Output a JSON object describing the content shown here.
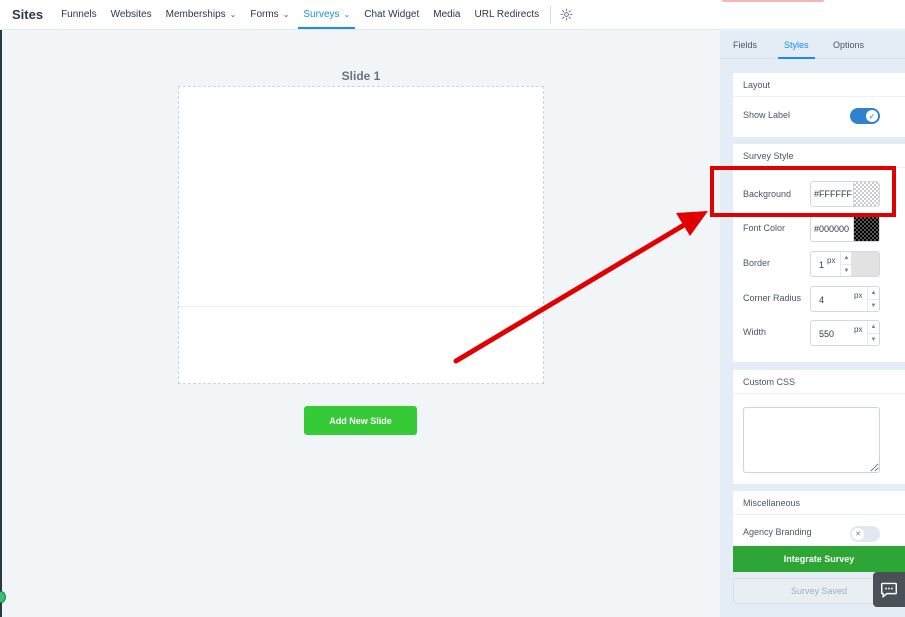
{
  "nav": {
    "brand": "Sites",
    "items": [
      {
        "label": "Funnels"
      },
      {
        "label": "Websites"
      },
      {
        "label": "Memberships"
      },
      {
        "label": "Forms"
      },
      {
        "label": "Surveys"
      },
      {
        "label": "Chat Widget"
      },
      {
        "label": "Media"
      },
      {
        "label": "URL Redirects"
      }
    ],
    "active": "Surveys",
    "accent_color": "#188bf6"
  },
  "canvas": {
    "slide_title": "Slide 1",
    "add_slide_label": "Add New Slide"
  },
  "panel": {
    "tabs": [
      {
        "label": "Fields"
      },
      {
        "label": "Styles"
      },
      {
        "label": "Options"
      }
    ],
    "active_tab": "Styles",
    "layout": {
      "header": "Layout",
      "show_label": "Show Label",
      "show_label_on": true
    },
    "survey_style": {
      "header": "Survey Style",
      "background_label": "Background",
      "background_value": "#FFFFFF",
      "font_color_label": "Font Color",
      "font_color_value": "#000000",
      "border_label": "Border",
      "border_value": "1",
      "border_unit": "px",
      "corner_radius_label": "Corner Radius",
      "corner_radius_value": "4",
      "corner_radius_unit": "px",
      "width_label": "Width",
      "width_value": "550",
      "width_unit": "px"
    },
    "custom_css": {
      "header": "Custom CSS",
      "value": ""
    },
    "misc": {
      "header": "Miscellaneous",
      "agency_branding": "Agency Branding",
      "agency_branding_on": false
    },
    "integrate_label": "Integrate Survey",
    "saved_label": "Survey Saved"
  },
  "colors": {
    "integrate_green": "#2ea636",
    "add_slide_green": "#37ca37",
    "annotation_red": "#e00000"
  }
}
